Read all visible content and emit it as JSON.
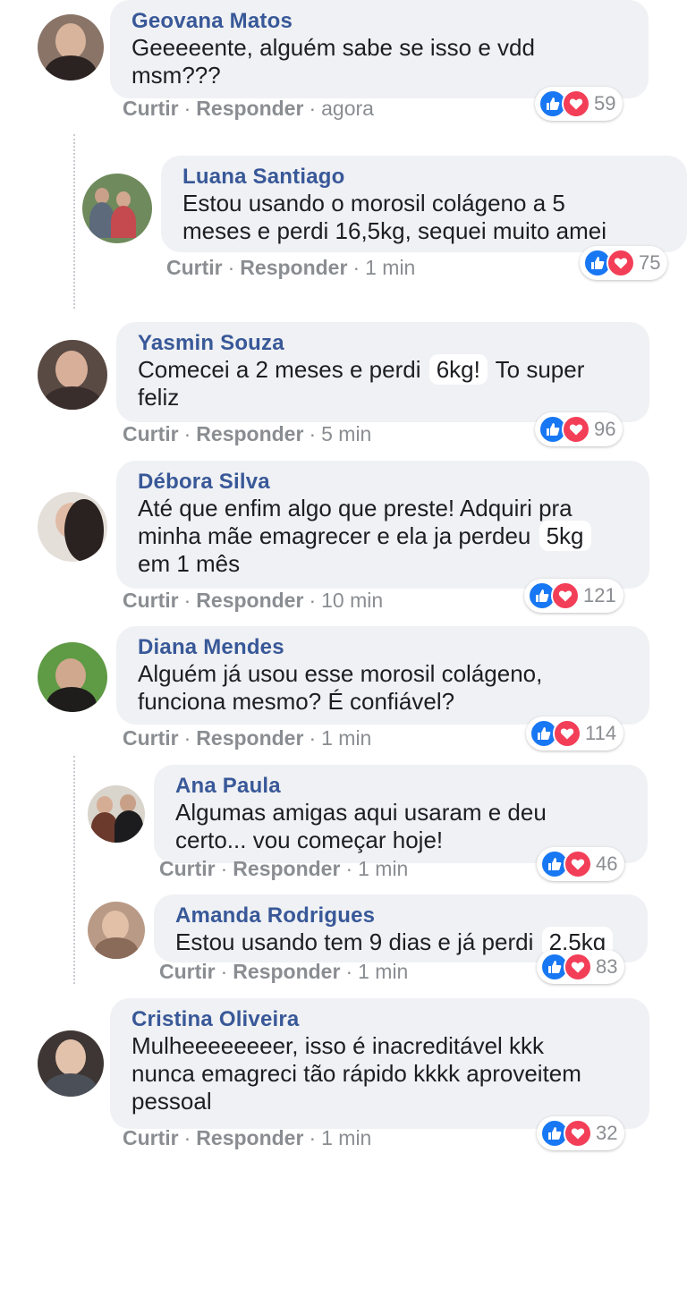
{
  "labels": {
    "like": "Curtir",
    "reply": "Responder",
    "dot": "·"
  },
  "colors": {
    "name": "#385898",
    "like": "#1877f2",
    "love": "#f33e58"
  },
  "comments": [
    {
      "name": "Geovana Matos",
      "text": "Geeeeente, alguém sabe se isso e vdd\nmsm???",
      "time": "agora",
      "count": "59"
    },
    {
      "name": "Luana Santiago",
      "text": "Estou usando o morosil colágeno a 5\nmeses e perdi 16,5kg, sequei muito amei",
      "time": "1 min",
      "count": "75"
    },
    {
      "name": "Yasmin Souza",
      "text_before": "Comecei a 2 meses e perdi",
      "highlight": "6kg!",
      "text_after": "To super\nfeliz",
      "time": "5 min",
      "count": "96"
    },
    {
      "name": "Débora Silva",
      "text_before": "Até que enfim algo que preste! Adquiri pra\nminha mãe emagrecer e ela ja perdeu",
      "highlight": "5kg",
      "text_after": "\nem 1 mês",
      "time": "10 min",
      "count": "121"
    },
    {
      "name": "Diana Mendes",
      "text": "Alguém já usou esse morosil colágeno,\nfunciona mesmo? É confiável?",
      "time": "1 min",
      "count": "114"
    },
    {
      "name": "Ana Paula",
      "text": "Algumas amigas aqui usaram e deu\ncerto... vou começar hoje!",
      "time": "1 min",
      "count": "46"
    },
    {
      "name": "Amanda Rodrigues",
      "text_before": "Estou usando tem 9 dias e já perdi",
      "highlight": "2,5kg",
      "time": "1 min",
      "count": "83"
    },
    {
      "name": "Cristina Oliveira",
      "text": "Mulheeeeeeeer, isso é inacreditável kkk\nnunca emagreci tão rápido kkkk aproveitem\npessoal",
      "time": "1 min",
      "count": "32"
    }
  ]
}
